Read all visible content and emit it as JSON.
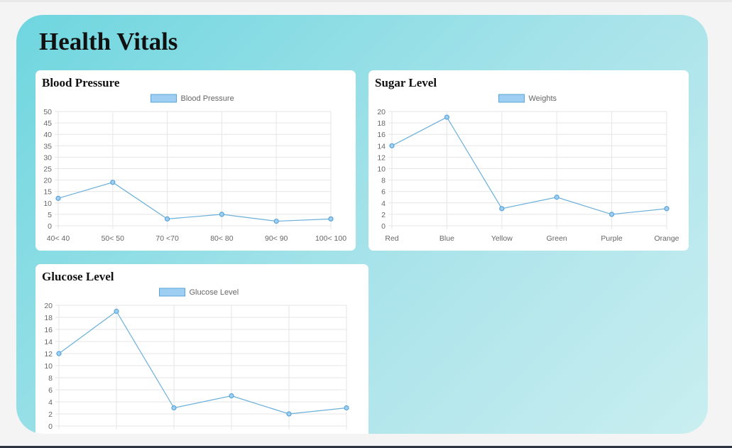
{
  "page": {
    "title": "Health Vitals"
  },
  "colors": {
    "line": "#6ab0d9",
    "point": "#5aa4d8",
    "legend_fill": "#9ecff3",
    "legend_stroke": "#5aa4d8",
    "grid": "#e6e6e6"
  },
  "chart_data": [
    {
      "type": "line",
      "title": "Blood Pressure",
      "categories": [
        "40< 40",
        "50< 50",
        "70 <70",
        "80< 80",
        "90< 90",
        "100< 100"
      ],
      "series": [
        {
          "name": "Blood Pressure",
          "values": [
            12,
            19,
            3,
            5,
            2,
            3
          ]
        }
      ],
      "ylim": [
        0,
        50
      ],
      "yticks": [
        "50",
        "45",
        "40",
        "35",
        "30",
        "25",
        "20",
        "15",
        "10",
        "5",
        "0"
      ],
      "legend": "top-center",
      "grid": true
    },
    {
      "type": "line",
      "title": "Sugar Level",
      "categories": [
        "Red",
        "Blue",
        "Yellow",
        "Green",
        "Purple",
        "Orange"
      ],
      "series": [
        {
          "name": "Weights",
          "values": [
            14,
            19,
            3,
            5,
            2,
            3
          ]
        }
      ],
      "ylim": [
        0,
        20
      ],
      "yticks": [
        "20",
        "18",
        "16",
        "14",
        "12",
        "10",
        "8",
        "6",
        "4",
        "2",
        "0"
      ],
      "legend": "top-center",
      "grid": true
    },
    {
      "type": "line",
      "title": "Glucose Level",
      "categories": [],
      "series": [
        {
          "name": "Glucose Level",
          "values": [
            12,
            19,
            3,
            5,
            2,
            3
          ]
        }
      ],
      "ylim": [
        0,
        20
      ],
      "yticks": [
        "20",
        "18",
        "16",
        "14",
        "12",
        "10",
        "8",
        "6",
        "4",
        "2",
        "0"
      ],
      "legend": "top-center",
      "grid": true
    }
  ]
}
